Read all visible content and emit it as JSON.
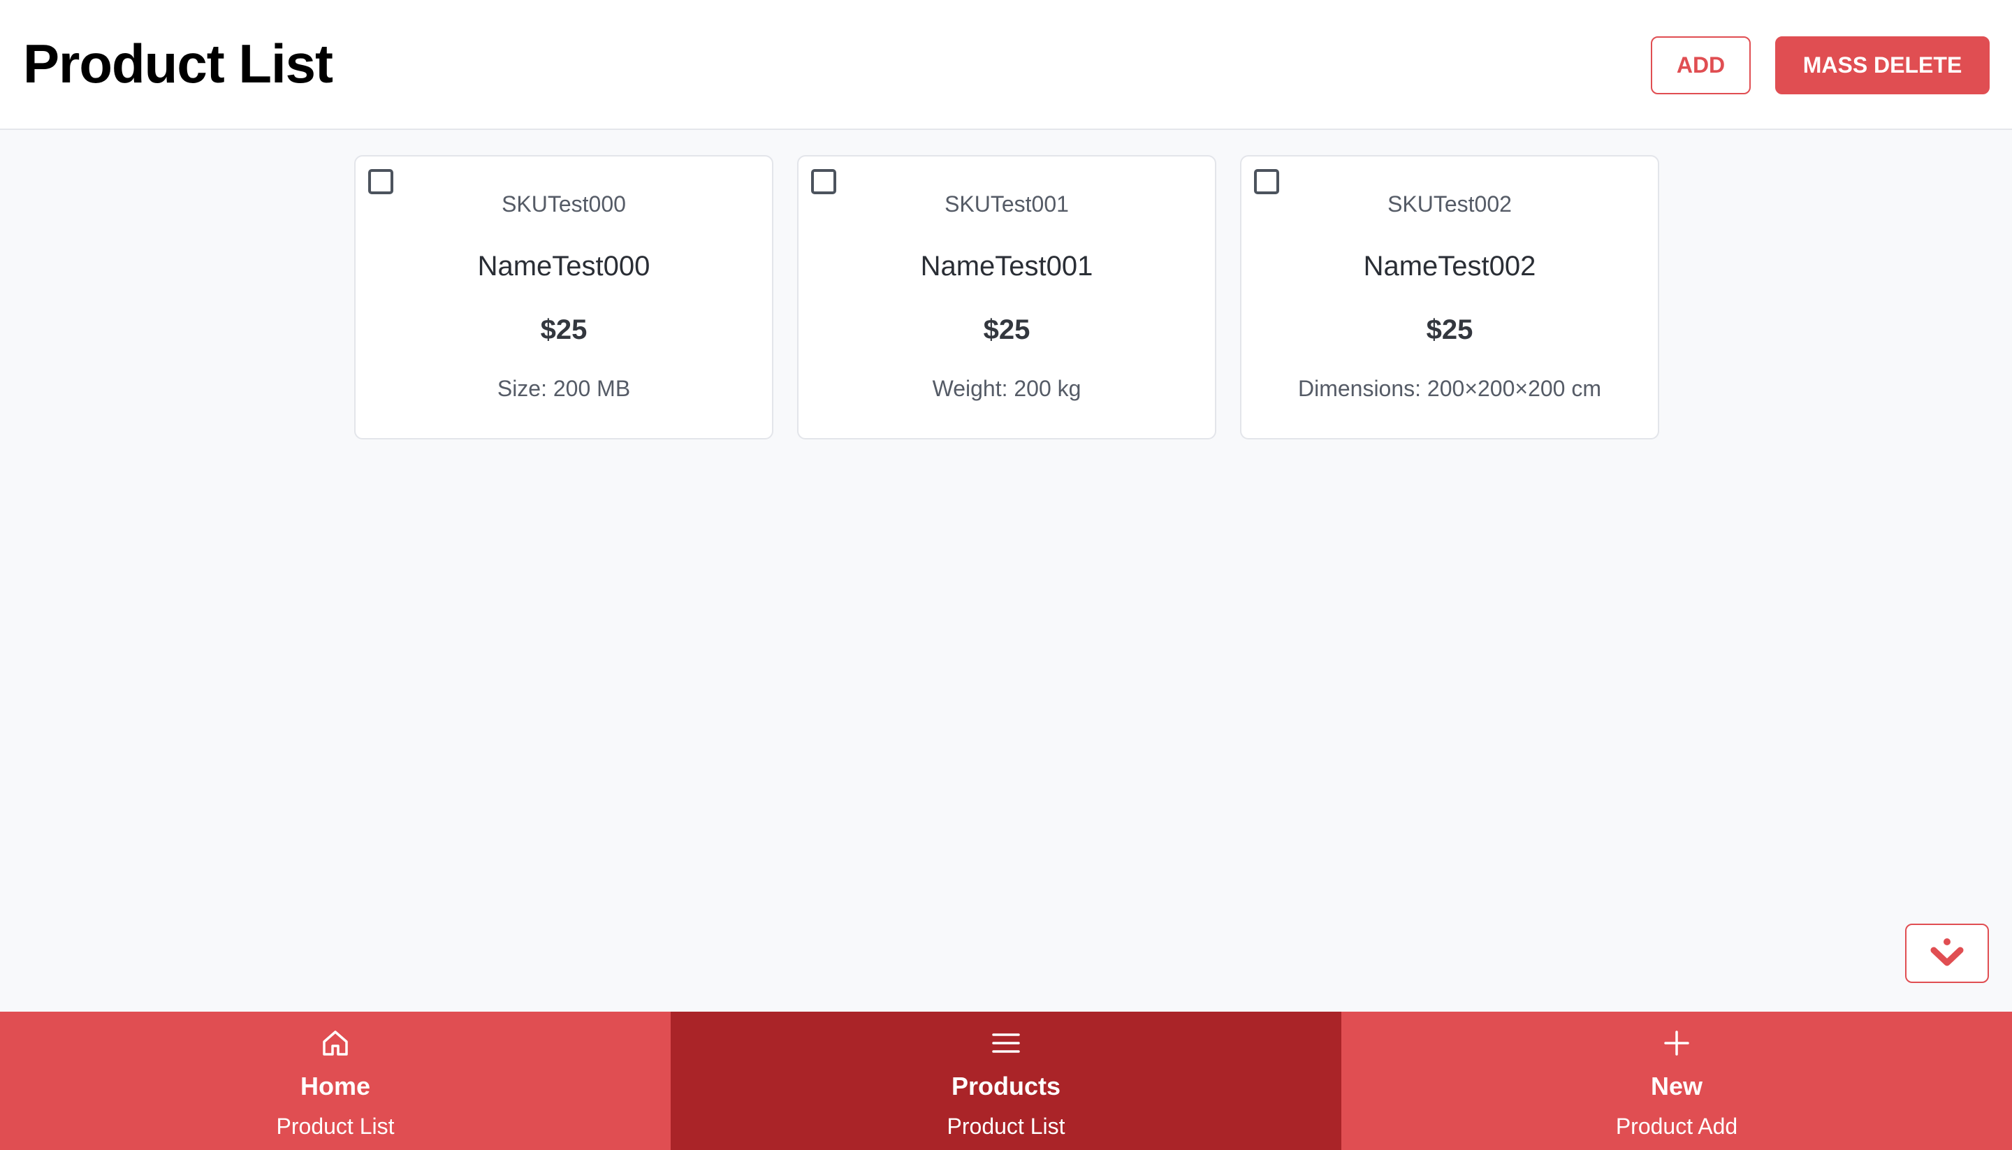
{
  "header": {
    "title": "Product List",
    "add_label": "ADD",
    "mass_delete_label": "MASS DELETE"
  },
  "products": [
    {
      "sku": "SKUTest000",
      "name": "NameTest000",
      "price": "$25",
      "attribute": "Size: 200 MB",
      "checked": false
    },
    {
      "sku": "SKUTest001",
      "name": "NameTest001",
      "price": "$25",
      "attribute": "Weight: 200 kg",
      "checked": false
    },
    {
      "sku": "SKUTest002",
      "name": "NameTest002",
      "price": "$25",
      "attribute": "Dimensions: 200×200×200 cm",
      "checked": false
    }
  ],
  "fab": {
    "icon": "chevron-down-icon"
  },
  "bottom_nav": [
    {
      "icon": "home-icon",
      "label": "Home",
      "sublabel": "Product List",
      "active": false
    },
    {
      "icon": "menu-icon",
      "label": "Products",
      "sublabel": "Product List",
      "active": true
    },
    {
      "icon": "plus-icon",
      "label": "New",
      "sublabel": "Product Add",
      "active": false
    }
  ],
  "colors": {
    "accent": "#e04e52",
    "accent_dark": "#aa2428",
    "background": "#f8f9fb"
  }
}
